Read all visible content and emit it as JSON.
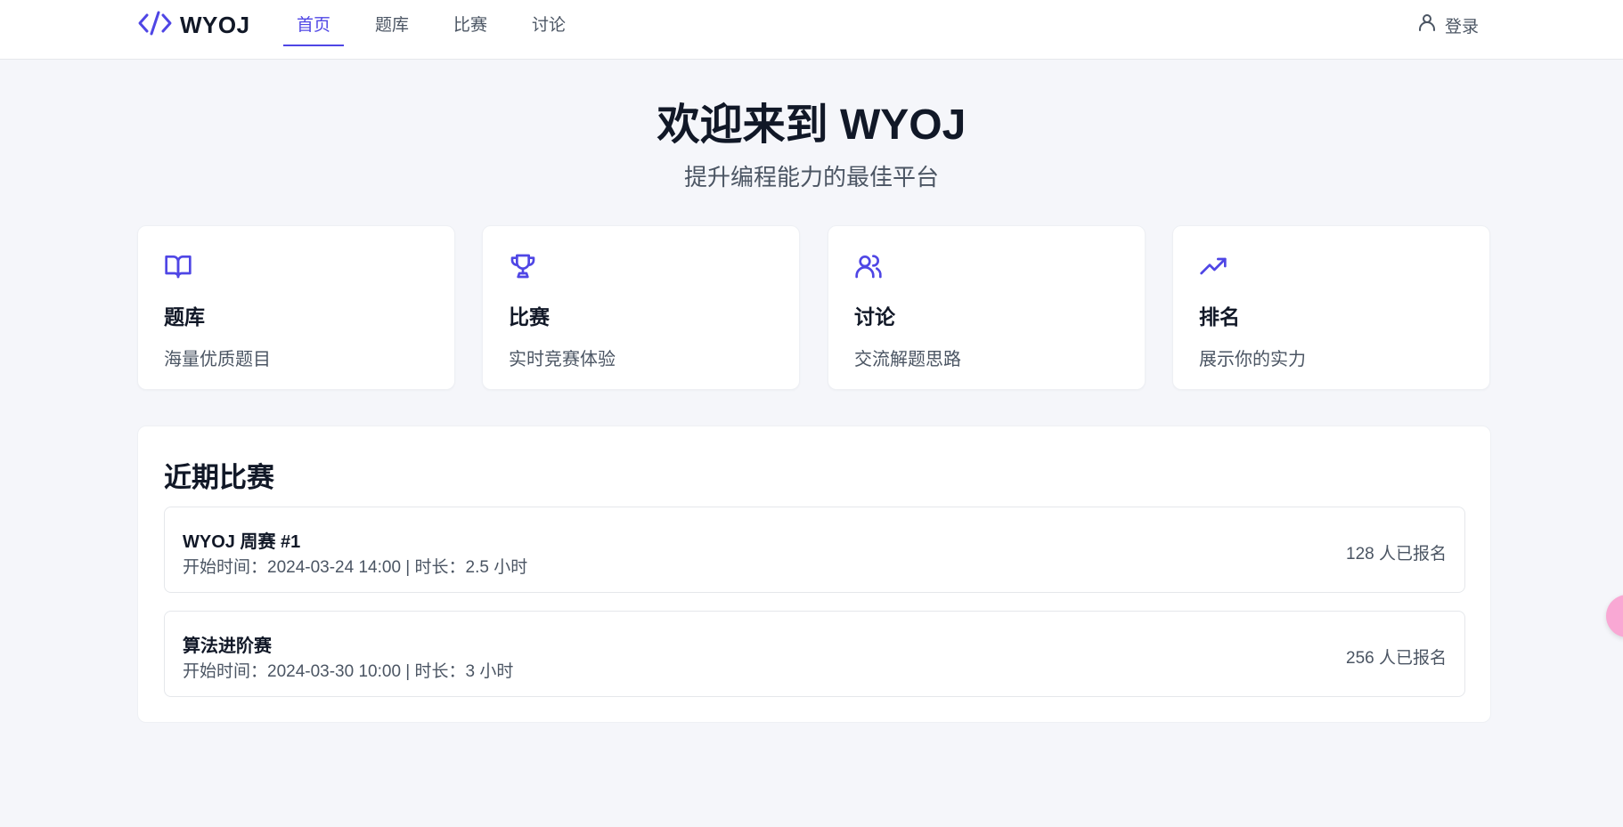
{
  "header": {
    "brand": "WYOJ",
    "nav": [
      {
        "label": "首页",
        "active": true
      },
      {
        "label": "题库",
        "active": false
      },
      {
        "label": "比赛",
        "active": false
      },
      {
        "label": "讨论",
        "active": false
      }
    ],
    "login_label": "登录"
  },
  "hero": {
    "title": "欢迎来到 WYOJ",
    "subtitle": "提升编程能力的最佳平台"
  },
  "features": [
    {
      "icon": "book-icon",
      "title": "题库",
      "desc": "海量优质题目"
    },
    {
      "icon": "trophy-icon",
      "title": "比赛",
      "desc": "实时竞赛体验"
    },
    {
      "icon": "users-icon",
      "title": "讨论",
      "desc": "交流解题思路"
    },
    {
      "icon": "trending-up-icon",
      "title": "排名",
      "desc": "展示你的实力"
    }
  ],
  "recent": {
    "title": "近期比赛",
    "contests": [
      {
        "name": "WYOJ 周赛 #1",
        "meta": "开始时间：2024-03-24 14:00 | 时长：2.5 小时",
        "count": "128 人已报名"
      },
      {
        "name": "算法进阶赛",
        "meta": "开始时间：2024-03-30 10:00 | 时长：3 小时",
        "count": "256 人已报名"
      }
    ]
  },
  "colors": {
    "accent": "#4f46e5",
    "background": "#f5f6fa",
    "floating_button": "#f9a8d4"
  }
}
